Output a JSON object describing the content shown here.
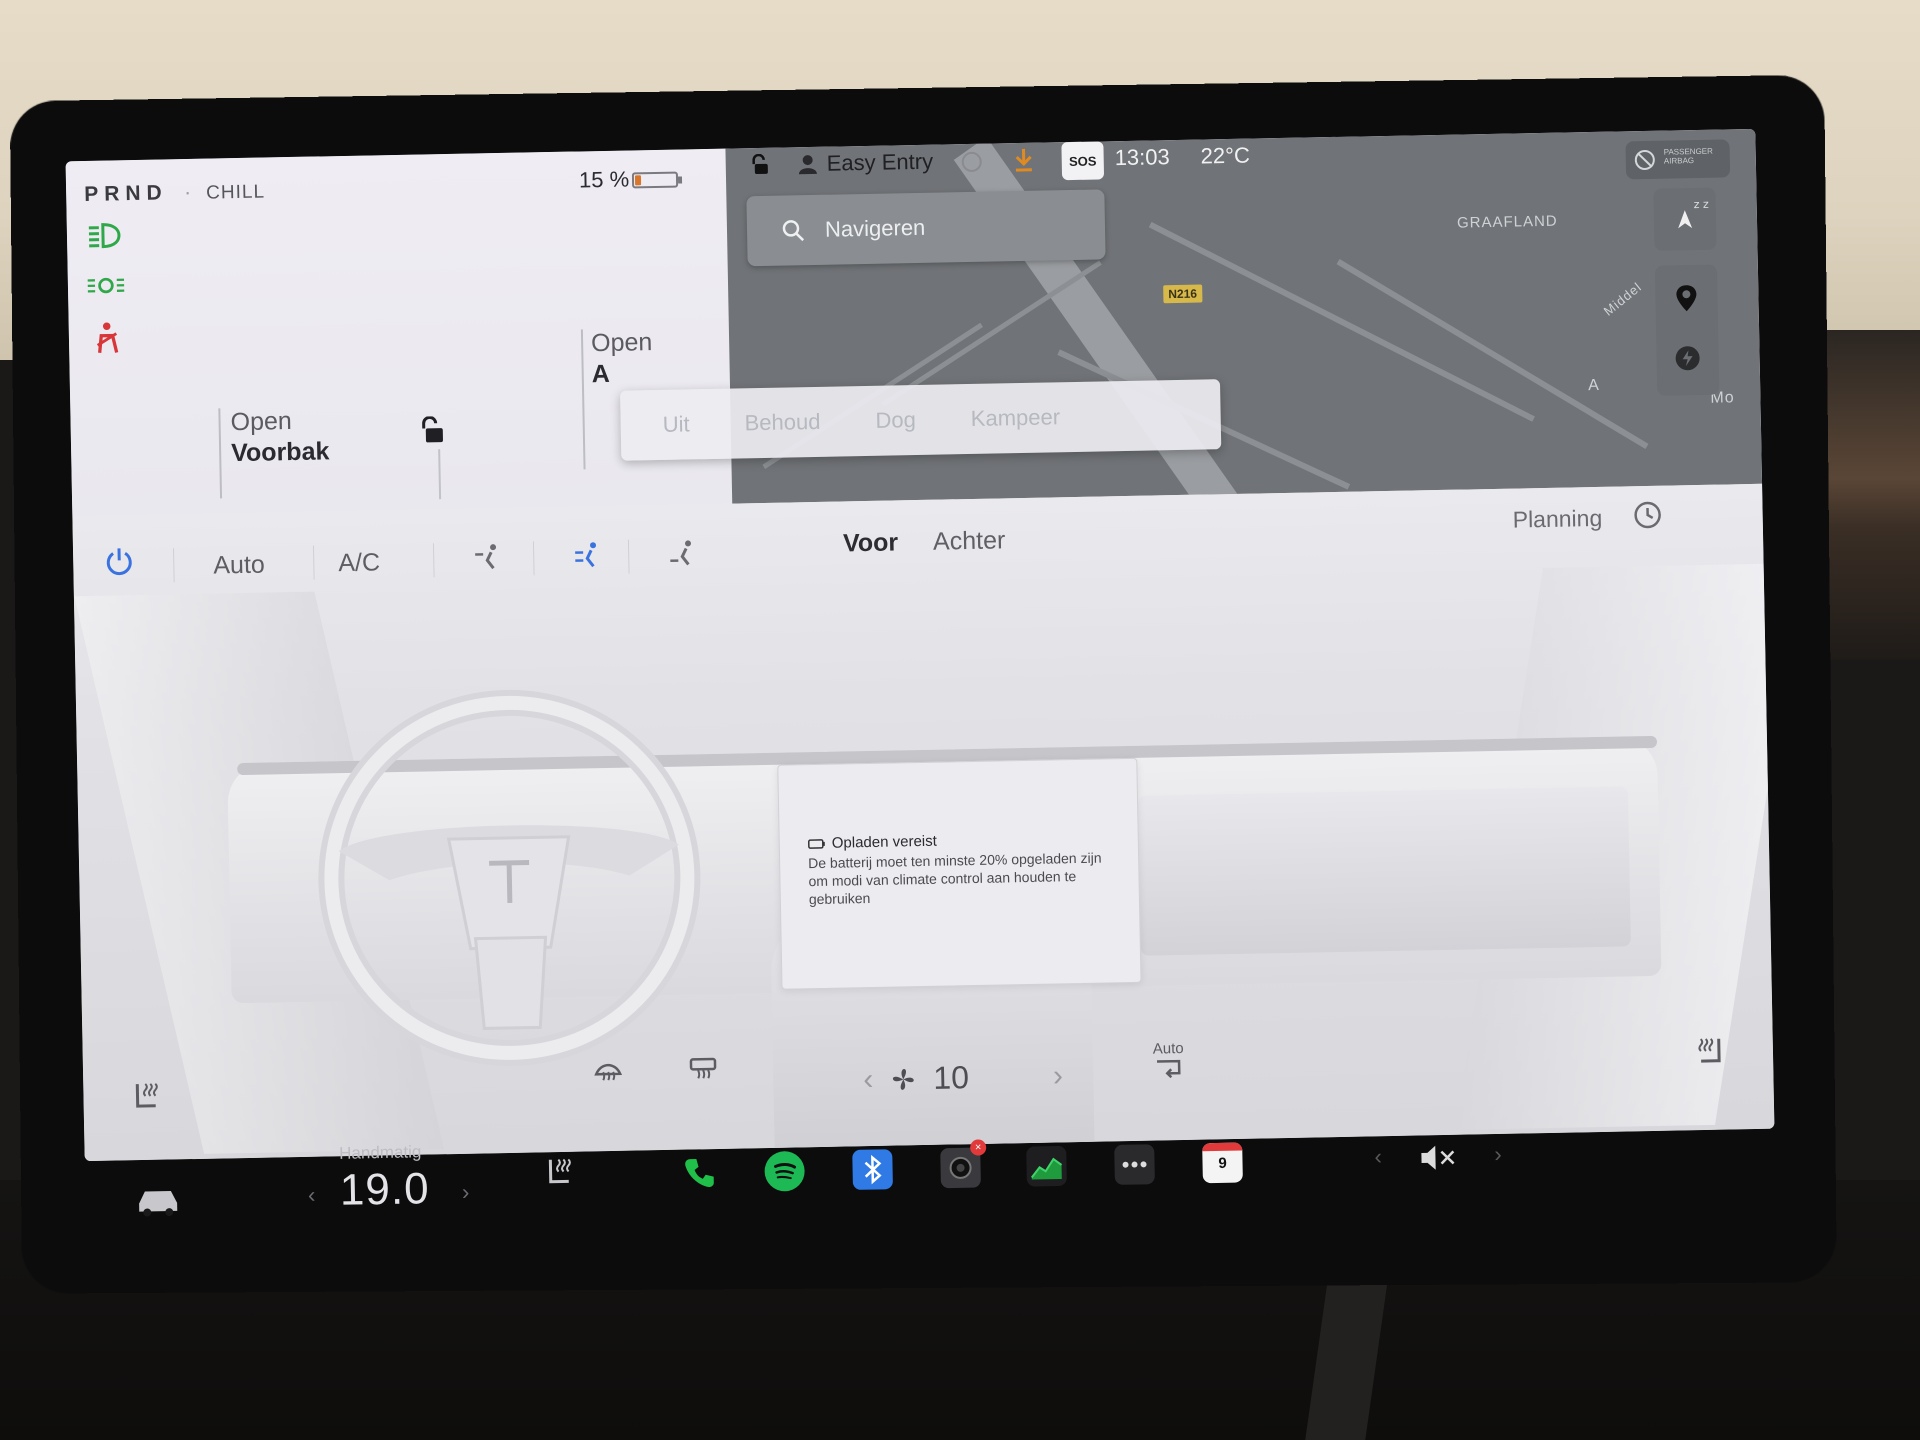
{
  "car": {
    "gear": "PRND",
    "drive_mode": "CHILL",
    "battery_percent": "15 %",
    "battery_level": 0.15,
    "front_trunk": {
      "line1": "Open",
      "line2": "Voorbak"
    },
    "rear_trunk": {
      "line1": "Open",
      "line2": "A"
    }
  },
  "status_bar": {
    "profile": "Easy Entry",
    "sos": "SOS",
    "time": "13:03",
    "temperature": "22°C",
    "airbag": "PASSENGER AIRBAG"
  },
  "map": {
    "search_placeholder": "Navigeren",
    "place_label": "GRAAFLAND",
    "road_badge": "N216",
    "road_label": "Middel",
    "partial_labels": [
      "A",
      "Mo"
    ]
  },
  "climate_modes": {
    "items": [
      "Uit",
      "Behoud",
      "Dog",
      "Kampeer"
    ]
  },
  "climate": {
    "auto": "Auto",
    "ac": "A/C",
    "tab_front": "Voor",
    "tab_rear": "Achter",
    "planning": "Planning",
    "fan_speed": "10",
    "recirc_label": "Auto",
    "notice": {
      "title": "Opladen vereist",
      "body": "De batterij moet ten minste 20% opgeladen zijn om modi van climate control aan houden te gebruiken"
    }
  },
  "dock": {
    "temp_label": "Handmatig",
    "temp_value": "19.0",
    "calendar_day": "9"
  },
  "colors": {
    "accent_blue": "#3a73e0",
    "phone_green": "#1fbf4a",
    "spotify_green": "#1db954",
    "battery_orange": "#d8762b",
    "warning_red": "#d8373a"
  }
}
